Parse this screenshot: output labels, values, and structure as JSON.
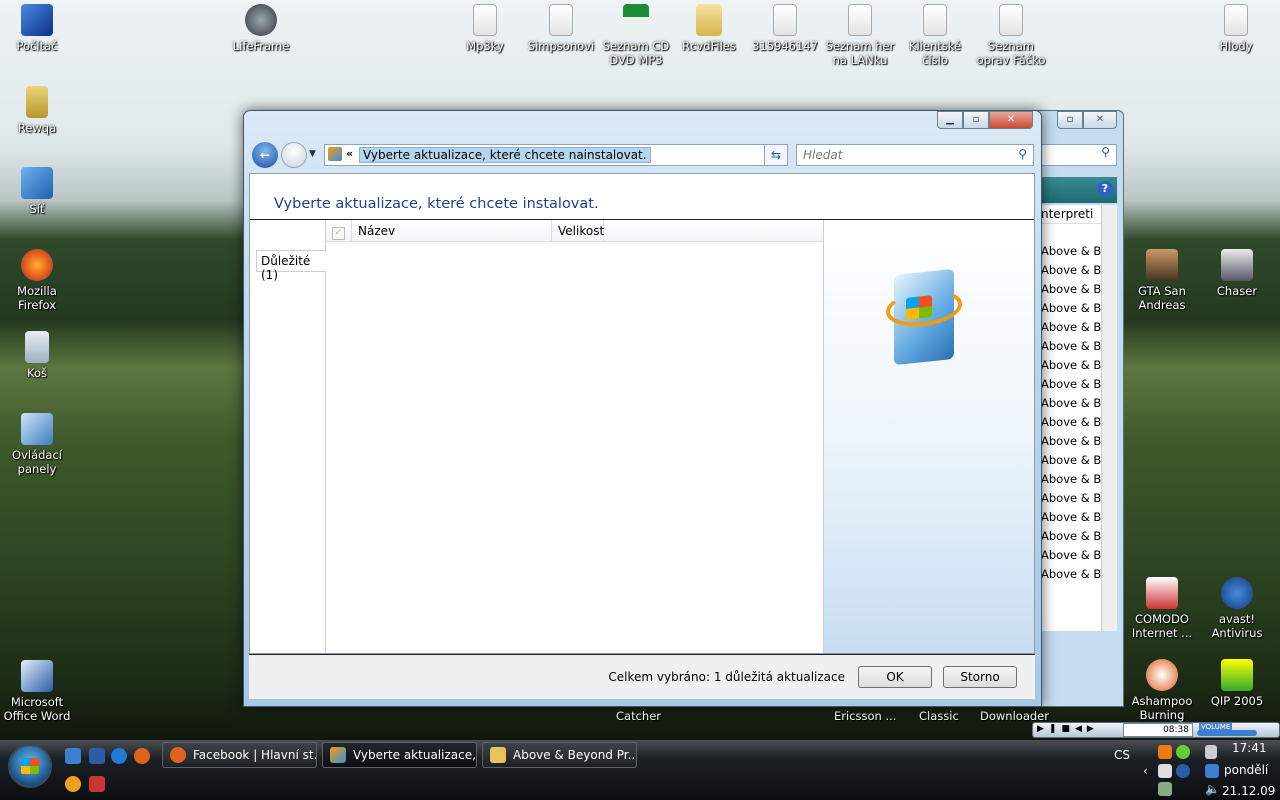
{
  "desktop": {
    "left_icons": [
      "Počítač",
      "Rewqa",
      "Síť",
      "Mozilla Firefox",
      "Koš",
      "Ovládací panely",
      "Microsoft Office Word"
    ],
    "top_icons": [
      "LifeFrame",
      "Mp3ky",
      "Simpsonovi",
      "Seznam CD DVD MP3",
      "RcvdFiles",
      "315946147",
      "Seznam her na LANku",
      "Klientské číslo",
      "Seznam oprav Fáčko",
      "Hlody"
    ],
    "right_icons": [
      "GTA San Andreas",
      "Chaser",
      "COMODO Internet ...",
      "avast! Antivirus",
      "Ashampoo Burning Stu...",
      "QIP 2005"
    ],
    "partial_labels": [
      "Catcher",
      "Ericsson ...",
      "Classic",
      "Downloader"
    ]
  },
  "back_window": {
    "column": "nterpreti",
    "rows": [
      "Above & Be",
      "Above & Be",
      "Above & Be",
      "Above & Be",
      "Above & Be",
      "Above & Be",
      "Above & Be",
      "Above & Be",
      "Above & Be",
      "Above & Be",
      "Above & Be",
      "Above & Be",
      "Above & Be",
      "Above & Be",
      "Above & Be",
      "Above & Be",
      "Above & Be",
      "Above & Be"
    ]
  },
  "window": {
    "address": "Vyberte aktualizace, které chcete nainstalovat.",
    "breadcrumb_chevron": "«",
    "search_placeholder": "Hledat",
    "heading": "Vyberte aktualizace, které chcete instalovat.",
    "tab": "Důležité (1)",
    "columns": [
      "Název",
      "Velikost"
    ],
    "status": "Celkem vybráno: 1 důležitá aktualizace",
    "ok": "OK",
    "cancel": "Storno"
  },
  "media_player": {
    "time": "08:38",
    "volume_label": "VOLUME"
  },
  "taskbar": {
    "buttons": [
      "Facebook | Hlavní st...",
      "Vyberte aktualizace, ...",
      "Above & Beyond Pr..."
    ],
    "language": "CS",
    "time": "17:41",
    "day": "pondělí",
    "date": "21.12.09"
  }
}
